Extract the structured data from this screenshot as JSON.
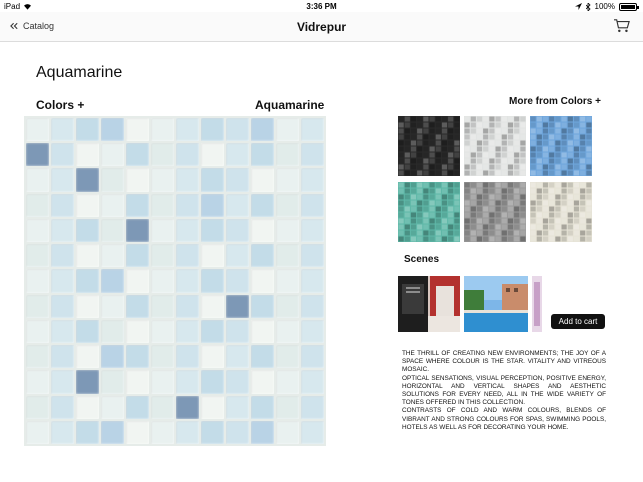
{
  "status_bar": {
    "device": "iPad",
    "time": "3:36 PM",
    "battery": "100%"
  },
  "nav": {
    "back_label": "Catalog",
    "title": "Vidrepur",
    "cart_icon": "cart-icon"
  },
  "product": {
    "title": "Aquamarine",
    "collection_label": "Colors +",
    "color_name": "Aquamarine",
    "mosaic_colors": [
      "#e9f1f0",
      "#d7e8ee",
      "#c3dce8",
      "#e1ecea",
      "#cfe3ec",
      "#f1f5f2",
      "#7d98b6",
      "#b9d3e6"
    ]
  },
  "related": {
    "label": "More from Colors +",
    "swatches": [
      {
        "name": "black-mosaic",
        "color": "#2a2a2a"
      },
      {
        "name": "white-mosaic",
        "color": "#e2e4e3"
      },
      {
        "name": "blue-mosaic",
        "color": "#6fa6dc"
      },
      {
        "name": "green-mosaic",
        "color": "#5fb8a8"
      },
      {
        "name": "grey-mosaic",
        "color": "#9a9a9a"
      },
      {
        "name": "cream-mosaic",
        "color": "#e6e3d6"
      }
    ]
  },
  "scenes": {
    "label": "Scenes",
    "add_to_cart": "Add to cart"
  },
  "description": [
    "THE THRILL OF CREATING NEW ENVIRONMENTS; THE JOY OF A SPACE WHERE COLOUR IS THE STAR. VITALITY AND VITREOUS MOSAIC.",
    "OPTICAL SENSATIONS, VISUAL PERCEPTION, POSITIVE ENERGY, HORIZONTAL AND VERTICAL SHAPES AND AESTHETIC SOLUTIONS FOR EVERY NEED, ALL IN THE WIDE VARIETY OF TONES OFFERED IN THIS COLLECTION.",
    "CONTRASTS OF COLD AND WARM COLOURS, BLENDS OF VIBRANT AND STRONG COLOURS FOR SPAS, SWIMMING POOLS, HOTELS AS WELL AS FOR DECORATING YOUR HOME."
  ]
}
